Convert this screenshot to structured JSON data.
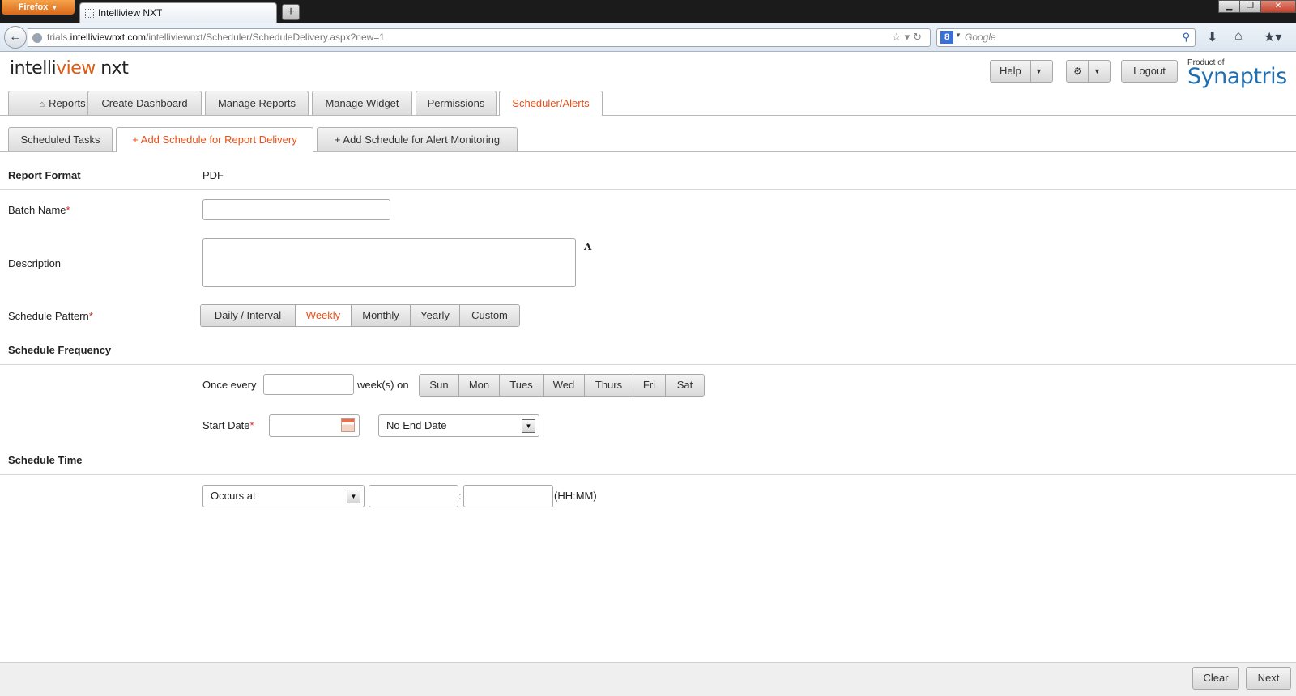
{
  "browser": {
    "app_button": "Firefox",
    "tab_title": "Intelliview NXT",
    "url_prefix": "trials.",
    "url_domain": "intelliviewnxt.com",
    "url_path": "/intelliviewnxt/Scheduler/ScheduleDelivery.aspx?new=1",
    "search_placeholder": "Google"
  },
  "header": {
    "logo_part1": "intelli",
    "logo_part2": "view",
    "logo_part3": " nxt",
    "help_label": "Help",
    "logout_label": "Logout",
    "product_of": "Product of",
    "company": "Synaptris"
  },
  "main_tabs": [
    {
      "label": "Reports"
    },
    {
      "label": "Create Dashboard"
    },
    {
      "label": "Manage Reports"
    },
    {
      "label": "Manage Widget"
    },
    {
      "label": "Permissions"
    },
    {
      "label": "Scheduler/Alerts"
    }
  ],
  "sub_tabs": [
    {
      "label": "Scheduled Tasks"
    },
    {
      "label": "+ Add Schedule for Report Delivery"
    },
    {
      "label": "+ Add Schedule for Alert Monitoring"
    }
  ],
  "form": {
    "report_format_label": "Report Format",
    "report_format_value": "PDF",
    "batch_name_label": "Batch Name",
    "description_label": "Description",
    "description_icon_text": "A",
    "schedule_pattern_label": "Schedule Pattern",
    "patterns": [
      "Daily / Interval",
      "Weekly",
      "Monthly",
      "Yearly",
      "Custom"
    ],
    "selected_pattern": "Weekly",
    "schedule_frequency_label": "Schedule Frequency",
    "once_every_label": "Once every",
    "weeks_on_label": "week(s) on",
    "days": [
      "Sun",
      "Mon",
      "Tues",
      "Wed",
      "Thurs",
      "Fri",
      "Sat"
    ],
    "start_date_label": "Start Date",
    "end_date_option": "No End Date",
    "schedule_time_label": "Schedule Time",
    "occurs_option": "Occurs at",
    "time_separator": ":",
    "time_format_hint": "(HH:MM)",
    "required_marker": "*"
  },
  "footer": {
    "clear_label": "Clear",
    "next_label": "Next"
  }
}
